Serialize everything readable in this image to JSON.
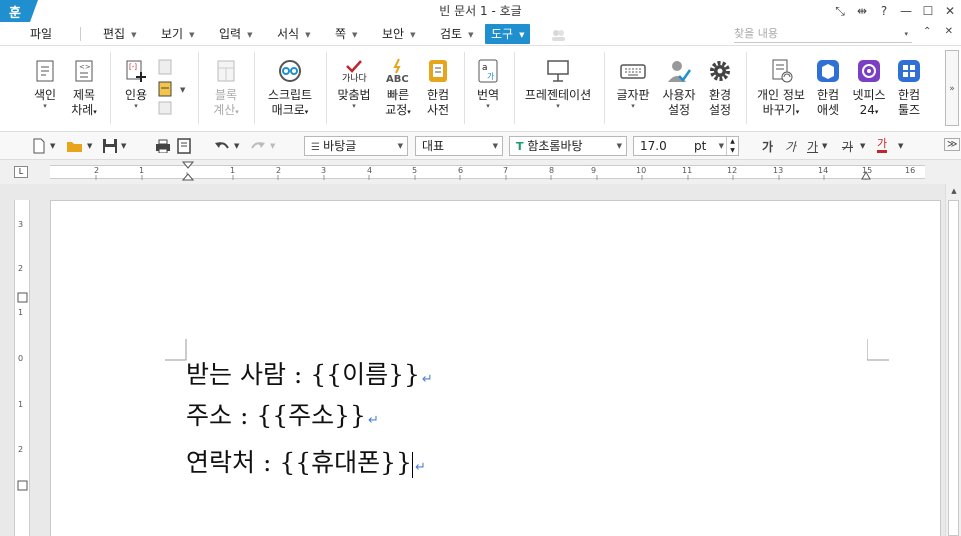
{
  "window": {
    "app_logo": "훈",
    "title": "빈 문서 1 - 호글",
    "controls": [
      "⤡",
      "⇹",
      "?",
      "—",
      "☐",
      "✕"
    ]
  },
  "menubar": {
    "items": [
      "파일",
      "편집",
      "보기",
      "입력",
      "서식",
      "쪽",
      "보안",
      "검토",
      "도구"
    ],
    "active": "도구",
    "search_placeholder": "찾을 내용",
    "right_controls": [
      "▾",
      "⌃",
      "✕"
    ]
  },
  "ribbon": {
    "buttons": [
      {
        "label1": "색인",
        "label2": ""
      },
      {
        "label1": "제목",
        "label2": "차례"
      },
      {
        "label1": "인용",
        "label2": ""
      },
      {
        "label1": "블록",
        "label2": "계산"
      },
      {
        "label1": "스크립트",
        "label2": "매크로"
      },
      {
        "label1": "맞춤법",
        "label2": ""
      },
      {
        "label1": "빠른",
        "label2": "교정"
      },
      {
        "label1": "한컴",
        "label2": "사전"
      },
      {
        "label1": "번역",
        "label2": ""
      },
      {
        "label1": "프레젠테이션",
        "label2": ""
      },
      {
        "label1": "글자판",
        "label2": ""
      },
      {
        "label1": "사용자",
        "label2": "설정"
      },
      {
        "label1": "환경",
        "label2": "설정"
      },
      {
        "label1": "개인 정보",
        "label2": "바꾸기"
      },
      {
        "label1": "한컴",
        "label2": "애셋"
      },
      {
        "label1": "넷피스",
        "label2": "24"
      },
      {
        "label1": "한컴",
        "label2": "툴즈"
      }
    ],
    "icon_text": {
      "spell": "가나다",
      "abc": "ABC",
      "translate_a": "a",
      "translate_ga": "가"
    }
  },
  "format_toolbar": {
    "style": "바탕글",
    "lang_group": "대표",
    "font": "함초롬바탕",
    "font_size": "17.0",
    "unit": "pt",
    "text_styles": [
      "가",
      "가",
      "가",
      "가",
      "가"
    ]
  },
  "ruler": {
    "corner": "L",
    "h_ticks": [
      "2",
      "1",
      "1",
      "2",
      "3",
      "4",
      "5",
      "6",
      "7",
      "8",
      "9",
      "10",
      "11",
      "12",
      "13",
      "14",
      "15",
      "16"
    ],
    "v_ticks": [
      "3",
      "2",
      "1",
      "0",
      "1",
      "2"
    ]
  },
  "document": {
    "lines": [
      "받는 사람 : {{이름}}",
      "주소 : {{주소}}",
      "연락처 : {{휴대폰}}"
    ],
    "para_mark": "↵"
  },
  "colors": {
    "accent": "#1f8fd0",
    "para_mark": "#4a7fd0"
  }
}
